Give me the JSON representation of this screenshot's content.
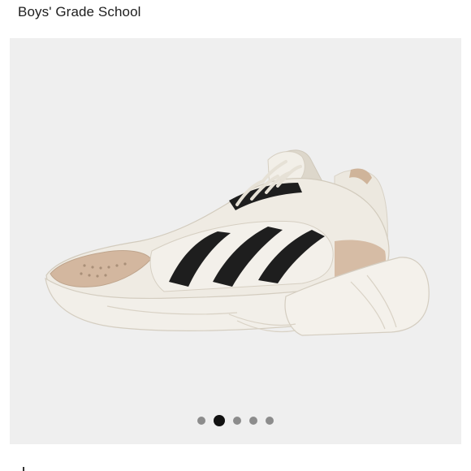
{
  "product": {
    "subtitle": "Boys' Grade School"
  },
  "gallery": {
    "image_count": 5,
    "active_index": 1
  },
  "colors": {
    "gallery_background": "#efefef",
    "shoe_body": "#efebe3",
    "stripes": "#1e1e1e",
    "accent_tan": "#d3b79f",
    "dot_inactive": "#8c8c8c",
    "dot_active": "#111111"
  }
}
